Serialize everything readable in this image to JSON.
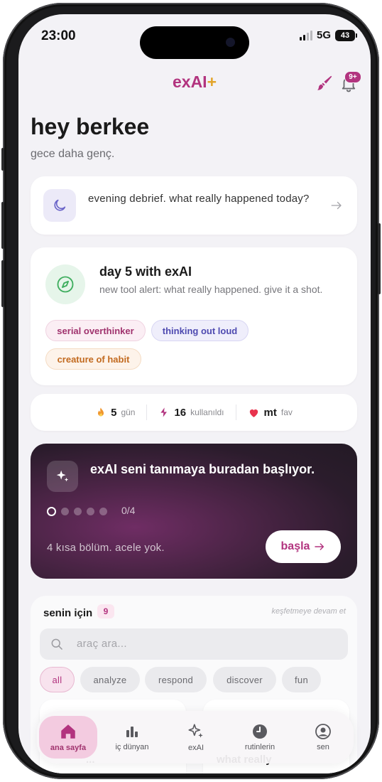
{
  "status_bar": {
    "time": "23:00",
    "network": "5G",
    "battery": "43"
  },
  "header": {
    "brand": "exAI",
    "brand_plus": "+",
    "notification_badge": "9+"
  },
  "greeting": {
    "title": "hey berkee",
    "subtitle": "gece daha genç."
  },
  "debrief_card": {
    "text": "evening debrief. what really happened today?"
  },
  "day_card": {
    "title": "day 5 with exAI",
    "subtitle": "new tool alert: what really happened. give it a shot.",
    "tags": [
      "serial overthinker",
      "thinking out loud",
      "creature of habit"
    ]
  },
  "stats": {
    "streak_value": "5",
    "streak_label": "gün",
    "used_value": "16",
    "used_label": "kullanıldı",
    "fav_value": "mt",
    "fav_label": "fav"
  },
  "onboarding": {
    "title": "exAI seni tanımaya buradan başlıyor.",
    "progress": "0/4",
    "progress_fraction": 0,
    "note": "4 kısa bölüm. acele yok.",
    "button": "başla"
  },
  "for_you": {
    "title": "senin için",
    "count": "9",
    "more": "keşfetmeye devam et",
    "search_placeholder": "araç ara...",
    "filters": [
      "all",
      "analyze",
      "respond",
      "discover",
      "fun"
    ],
    "selected_filter": "all",
    "peek_left": "...",
    "peek_right": "what really"
  },
  "tabbar": {
    "items": [
      "ana sayfa",
      "iç dünyan",
      "exAI",
      "rutinlerin",
      "sen"
    ],
    "active": "ana sayfa"
  },
  "colors": {
    "brand": "#b2347f",
    "accent_gold": "#e2a52c",
    "background": "#f3f2f6",
    "onboarding_dark": "#2b1c2c"
  }
}
